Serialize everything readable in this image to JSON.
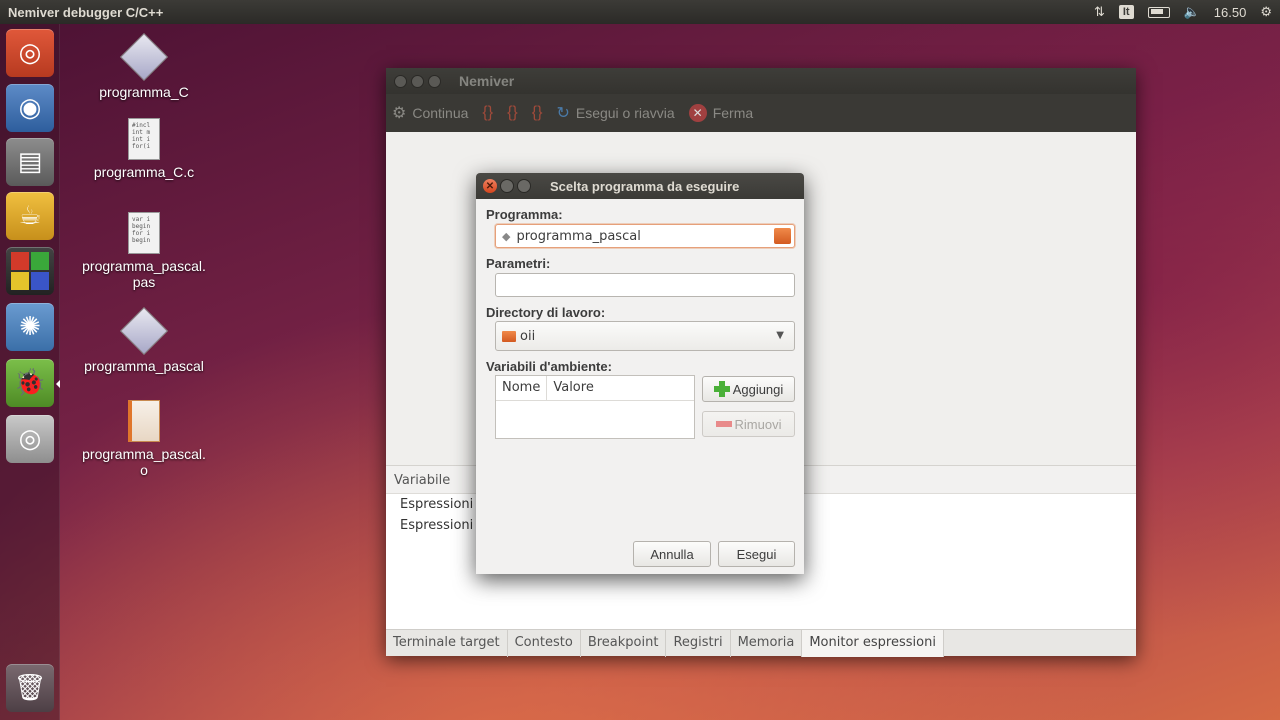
{
  "top_panel": {
    "app_title": "Nemiver debugger C/C++",
    "keyboard_layout": "It",
    "clock": "16.50"
  },
  "desktop_icons": [
    {
      "label": "programma_C",
      "type": "executable"
    },
    {
      "label": "programma_C.c",
      "type": "c-source"
    },
    {
      "label": "programma_pascal.\npas",
      "line1": "programma_pascal.",
      "line2": "pas",
      "type": "pascal-source"
    },
    {
      "label": "programma_pascal",
      "type": "executable"
    },
    {
      "label": "programma_pascal.\no",
      "line1": "programma_pascal.",
      "line2": "o",
      "type": "object-file"
    }
  ],
  "c_preview": [
    "#incl",
    "int m",
    "int i",
    "for(i"
  ],
  "pas_preview": [
    "var i",
    "begin",
    "for i",
    "  begin"
  ],
  "nemiver": {
    "title": "Nemiver",
    "toolbar": {
      "continue_label": "Continua",
      "run_restart_label": "Esegui o riavvia",
      "stop_label": "Ferma"
    },
    "variables_header": "Variabile",
    "expression_rows": [
      "Espressioni",
      "Espressioni"
    ],
    "tabs": [
      "Terminale target",
      "Contesto",
      "Breakpoint",
      "Registri",
      "Memoria",
      "Monitor espressioni"
    ],
    "active_tab": "Monitor espressioni"
  },
  "dialog": {
    "title": "Scelta programma da eseguire",
    "program_label": "Programma:",
    "program_value": "programma_pascal",
    "params_label": "Parametri:",
    "params_value": "",
    "workdir_label": "Directory di lavoro:",
    "workdir_value": "oii",
    "env_label": "Variabili d'ambiente:",
    "env_columns": [
      "Nome",
      "Valore"
    ],
    "add_label": "Aggiungi",
    "remove_label": "Rimuovi",
    "cancel_label": "Annulla",
    "run_label": "Esegui"
  },
  "colors": {
    "panel": "#3c3b37",
    "dialog_close": "#d5461e",
    "accent_orange": "#e0762b"
  }
}
